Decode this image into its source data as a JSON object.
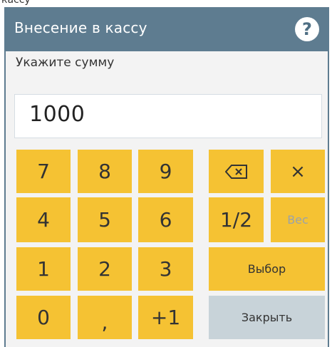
{
  "top_strip_text": "кассу",
  "dialog": {
    "title": "Внесение в кассу",
    "help_label": "?",
    "prompt": "Укажите сумму",
    "amount": "1000"
  },
  "keypad": {
    "digits": {
      "k7": "7",
      "k8": "8",
      "k9": "9",
      "k4": "4",
      "k5": "5",
      "k6": "6",
      "k1": "1",
      "k2": "2",
      "k3": "3",
      "k0": "0",
      "comma": ",",
      "plus1": "+1"
    },
    "clear": "×",
    "half": "1/2",
    "weight": "Вес",
    "select": "Выбор",
    "close": "Закрыть",
    "backspace_icon": "backspace-icon"
  },
  "colors": {
    "title_bar": "#5e7c90",
    "key_yellow": "#f5c233",
    "key_grey": "#c8d3d9"
  }
}
